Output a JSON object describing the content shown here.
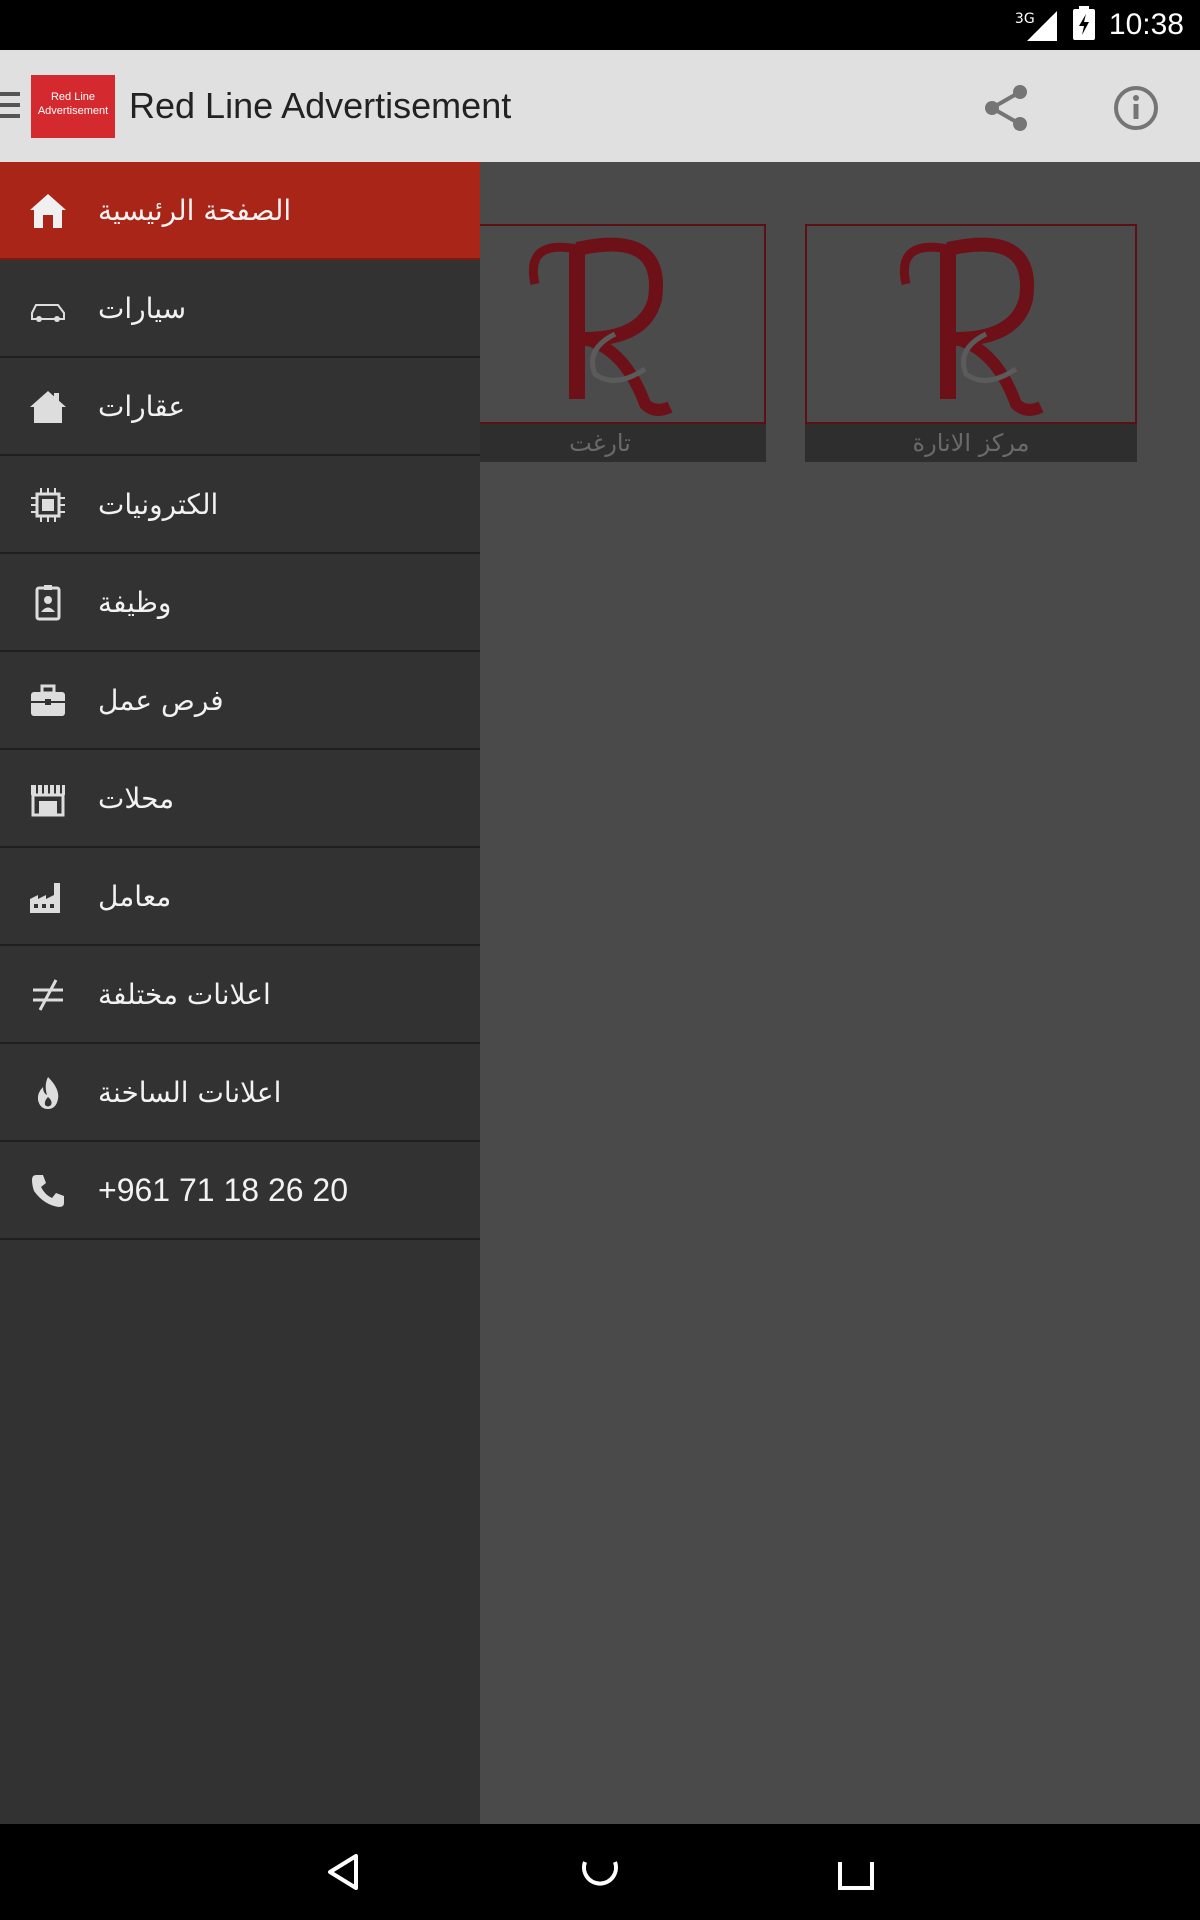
{
  "status_bar": {
    "network": "3G",
    "time": "10:38"
  },
  "app_bar": {
    "logo_text": "Red Line Advertisement",
    "title": "Red Line Advertisement",
    "actions": [
      "share-icon",
      "info-icon"
    ]
  },
  "cards": [
    {
      "label": "تارغت",
      "image": "R"
    },
    {
      "label": "مركز الانارة",
      "image": "R"
    }
  ],
  "drawer": {
    "items": [
      {
        "label": "الصفحة الرئيسية",
        "icon": "home-icon",
        "active": true
      },
      {
        "label": "سيارات",
        "icon": "car-icon"
      },
      {
        "label": "عقارات",
        "icon": "house-icon"
      },
      {
        "label": "الكترونيات",
        "icon": "chip-icon"
      },
      {
        "label": "وظيفة",
        "icon": "badge-icon"
      },
      {
        "label": "فرص عمل",
        "icon": "briefcase-icon"
      },
      {
        "label": "محلات",
        "icon": "store-icon"
      },
      {
        "label": "معامل",
        "icon": "factory-icon"
      },
      {
        "label": "اعلانات مختلفة",
        "icon": "not-equal-icon"
      },
      {
        "label": "اعلانات الساخنة",
        "icon": "fire-icon"
      },
      {
        "label": "+961 71 18 26 20",
        "icon": "phone-icon"
      }
    ]
  },
  "colors": {
    "active_item": "#a92517",
    "drawer_bg": "#323232",
    "app_bar_bg": "#e0e0e0",
    "logo_bg": "#d42a2f"
  },
  "nav_bar": [
    "back-icon",
    "home-circle-icon",
    "recents-icon"
  ]
}
